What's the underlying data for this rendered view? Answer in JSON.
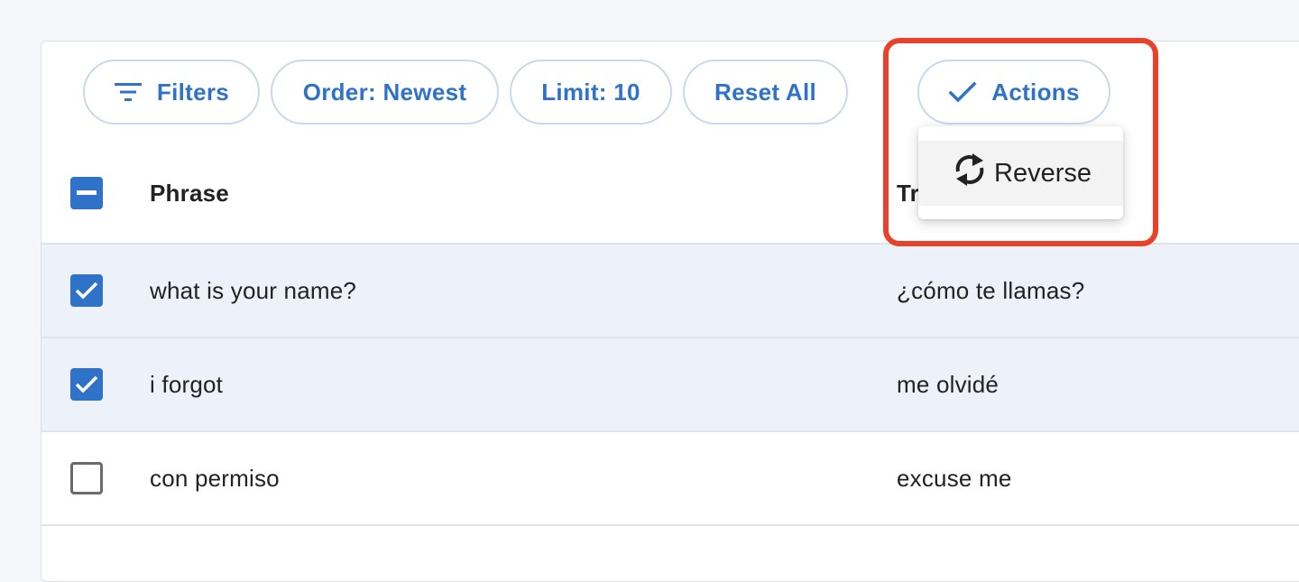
{
  "toolbar": {
    "filters_label": "Filters",
    "order_label": "Order: Newest",
    "limit_label": "Limit: 10",
    "reset_label": "Reset All",
    "actions_label": "Actions"
  },
  "actions_menu": {
    "items": [
      {
        "label": "Reverse",
        "icon": "sync-icon"
      }
    ]
  },
  "table": {
    "columns": [
      "Phrase",
      "Tr"
    ],
    "header_checkbox_state": "indeterminate",
    "rows": [
      {
        "phrase": "what is your name?",
        "translation": "¿cómo te llamas?",
        "selected": true
      },
      {
        "phrase": "i forgot",
        "translation": "me olvidé",
        "selected": true
      },
      {
        "phrase": "con permiso",
        "translation": "excuse me",
        "selected": false
      }
    ]
  },
  "colors": {
    "accent": "#2f73c9",
    "chip_border": "#c9d9ec",
    "selected_row": "#edf2fa",
    "highlight": "#e8432a"
  }
}
